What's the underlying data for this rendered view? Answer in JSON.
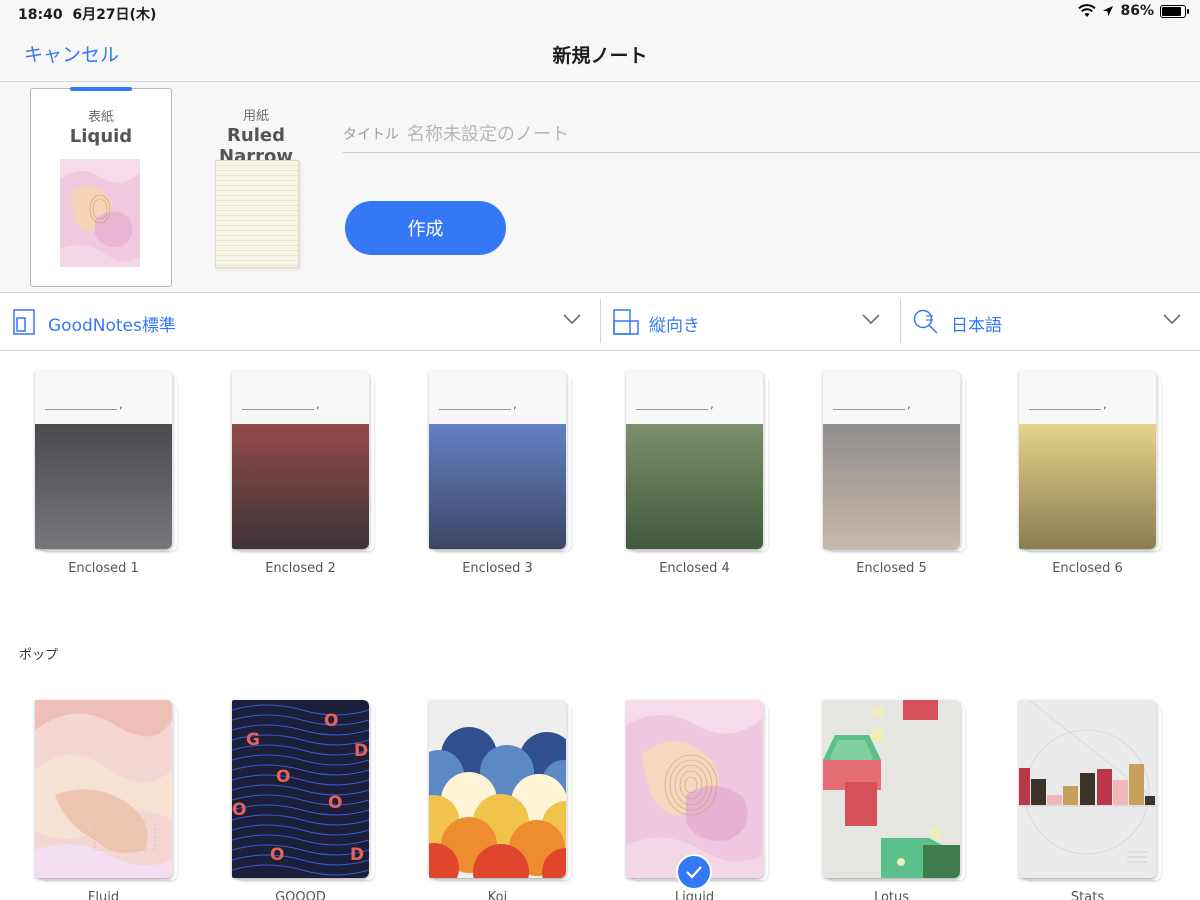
{
  "status_bar": {
    "time": "18:40",
    "date": "6月27日(木)",
    "battery": "86%",
    "battery_level": 0.86
  },
  "nav": {
    "cancel_label": "キャンセル",
    "title": "新規ノート"
  },
  "cover_selector": {
    "caption": "表紙",
    "value": "Liquid"
  },
  "paper_selector": {
    "caption": "用紙",
    "value": "Ruled Narrow"
  },
  "title_field": {
    "label": "タイトル",
    "placeholder": "名称未設定のノート",
    "value": ""
  },
  "create_button": {
    "label": "作成"
  },
  "filters": [
    {
      "label": "GoodNotes標準",
      "icon": "template-icon"
    },
    {
      "label": "縦向き",
      "icon": "orientation-icon"
    },
    {
      "label": "日本語",
      "icon": "language-search-icon"
    }
  ],
  "enclosed_notebooks": [
    {
      "name": "Enclosed 1",
      "colors": [
        "#4b4b4f",
        "#77777b"
      ]
    },
    {
      "name": "Enclosed 2",
      "colors": [
        "#934a48",
        "#3e3439"
      ]
    },
    {
      "name": "Enclosed 3",
      "colors": [
        "#6480c4",
        "#3b4663"
      ]
    },
    {
      "name": "Enclosed 4",
      "colors": [
        "#7b8f6b",
        "#415a3d"
      ]
    },
    {
      "name": "Enclosed 5",
      "colors": [
        "#8f8d8d",
        "#c7b9ac"
      ]
    },
    {
      "name": "Enclosed 6",
      "colors": [
        "#e5d38b",
        "#8a7d52"
      ]
    }
  ],
  "pop_section": {
    "label": "ポップ"
  },
  "pop_notebooks": [
    {
      "name": "Fluid"
    },
    {
      "name": "GOOOD"
    },
    {
      "name": "Koi"
    },
    {
      "name": "Liquid",
      "selected": true
    },
    {
      "name": "Lotus"
    },
    {
      "name": "Stats"
    }
  ],
  "colors": {
    "accent": "#3478f6"
  }
}
